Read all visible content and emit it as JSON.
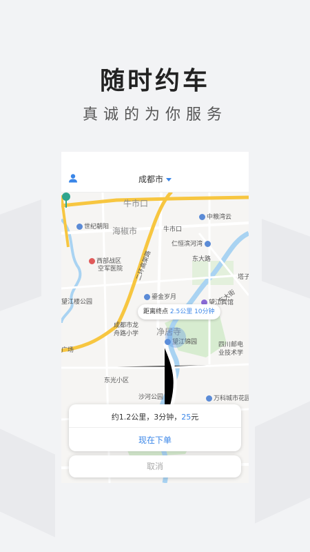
{
  "hero": {
    "title": "随时约车",
    "subtitle": "真诚的为你服务"
  },
  "app": {
    "city": "成都市",
    "user_icon": "user-icon",
    "dropdown_icon": "caret-down-icon"
  },
  "map": {
    "labels": {
      "niushikou_big": "牛市口",
      "haijiaoshi": "海椒市",
      "shijichaoyang": "世纪朝阳",
      "zhongliangwanyun": "中粮湾云",
      "niushikou_small": "牛市口",
      "renhengbinhe": "仁恒滨河湾",
      "dongdalu": "东大路",
      "xibuzhanqu": "西部战区",
      "kongjunyiyuan": "空军医院",
      "wangjianglou": "望江楼公园",
      "eryihuan": "二环高架路",
      "lujinsuiyue": "鎏金岁月",
      "wangjiangbinguan": "望江宾馆",
      "chengdulongzhou": "成都市龙",
      "zhoulu_xiaoxue": "舟路小学",
      "jingjusi": "净居寺",
      "wangjiangjinyuan": "望江锦园",
      "sichuanyoudian": "四川邮电",
      "yejishu": "业技术学",
      "dongguangxiaoqu": "东光小区",
      "shahegongyuan": "沙河公园",
      "wankecheng": "万科城市花园",
      "guangchang": "广场",
      "dongdajie": "东大街",
      "tazi": "塔子"
    },
    "tooltip": {
      "prefix": "距离终点",
      "highlight": "2.5公里 10分钟"
    },
    "pin_icon": "location-pin-icon"
  },
  "order": {
    "fare_prefix": "约1.2公里，3分钟，",
    "fare_price": "25",
    "fare_unit": "元",
    "order_button": "现在下单",
    "cancel_button": "取消"
  },
  "colors": {
    "accent": "#3a86e8",
    "arterial_road": "#f7c640"
  }
}
